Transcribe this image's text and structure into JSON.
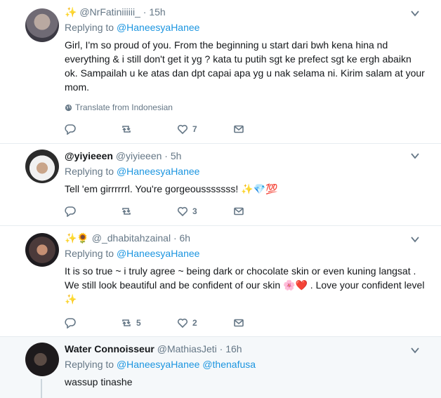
{
  "tweets": [
    {
      "emoji_prefix": "✨",
      "display_name": "",
      "handle": "@NrFatiniiiiii_",
      "time": "15h",
      "replying_label": "Replying to",
      "replying_to": "@HaneesyaHanee",
      "text": "Girl, I'm so proud of you. From the beginning u start dari bwh kena hina nd everything & i still don't get it yg ? kata tu putih sgt ke prefect sgt ke ergh abaikn ok. Sampailah u ke atas dan dpt capai apa yg u nak selama ni. Kirim salam at your mom.",
      "translate": "Translate from Indonesian",
      "replies": "",
      "retweets": "",
      "likes": "7"
    },
    {
      "emoji_prefix": "",
      "display_name": "@yiyieeen",
      "handle": "@yiyieeen",
      "time": "5h",
      "replying_label": "Replying to",
      "replying_to": "@HaneesyaHanee",
      "text": "Tell 'em girrrrrrl. You're gorgeousssssss! ✨💎💯",
      "replies": "",
      "retweets": "",
      "likes": "3"
    },
    {
      "emoji_prefix": "✨🌻",
      "display_name": "",
      "handle": "@_dhabitahzainal",
      "time": "6h",
      "replying_label": "Replying to",
      "replying_to": "@HaneesyaHanee",
      "text": "It is so true ~ i truly agree ~ being dark or chocolate skin or even kuning langsat . We still look beautiful and be confident of our skin 🌸❤️ . Love your confident level ✨",
      "replies": "",
      "retweets": "5",
      "likes": "2"
    },
    {
      "emoji_prefix": "",
      "display_name": "Water Connoisseur",
      "handle": "@MathiasJeti",
      "time": "16h",
      "replying_label": "Replying to",
      "replying_to": "@HaneesyaHanee @thenafusa",
      "text": "wassup tinashe"
    }
  ],
  "colors": {
    "link": "#1b95e0",
    "muted": "#657786",
    "border": "#e6ecf0"
  },
  "icons": [
    "reply-icon",
    "retweet-icon",
    "like-icon",
    "message-icon",
    "chevron-down-icon",
    "globe-icon"
  ]
}
